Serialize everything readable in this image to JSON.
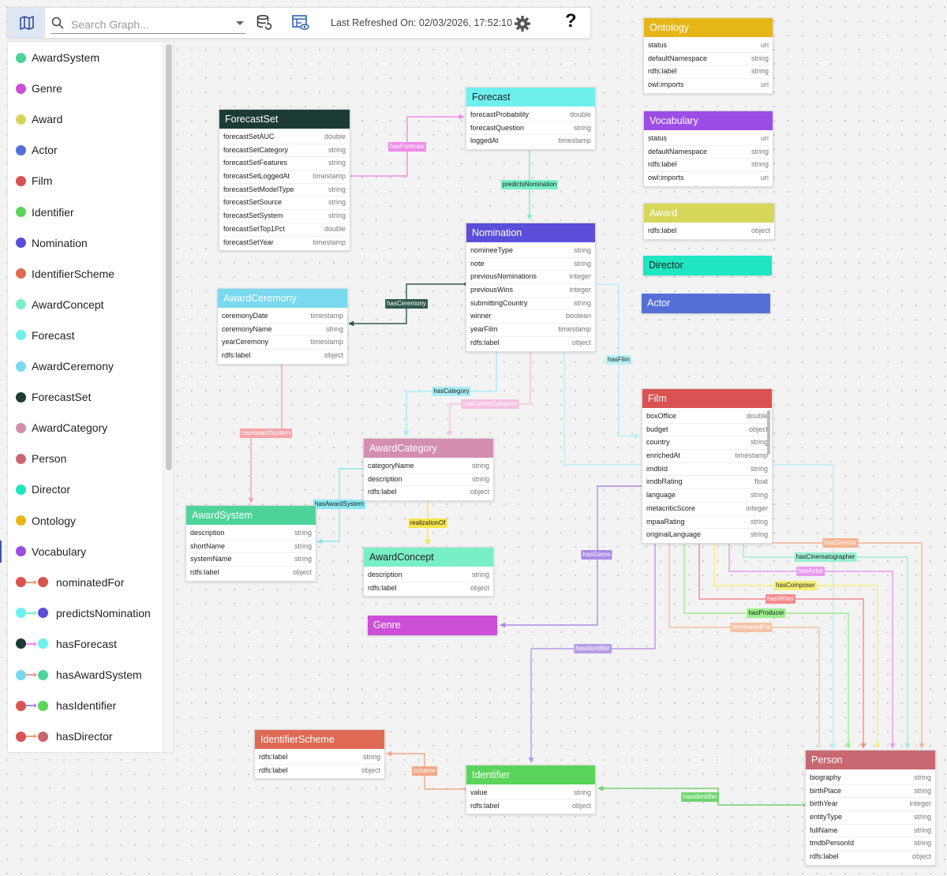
{
  "toolbar": {
    "search_placeholder": "Search Graph...",
    "last_refreshed": "Last Refreshed On: 02/03/2026, 17:52:10",
    "help": "?"
  },
  "legend": {
    "nodes": [
      {
        "label": "AwardSystem",
        "color": "#4ed39a"
      },
      {
        "label": "Genre",
        "color": "#cc4fd8"
      },
      {
        "label": "Award",
        "color": "#d6d65a"
      },
      {
        "label": "Actor",
        "color": "#5470d6"
      },
      {
        "label": "Film",
        "color": "#d95352"
      },
      {
        "label": "Identifier",
        "color": "#5ad45a"
      },
      {
        "label": "Nomination",
        "color": "#5b4ed8"
      },
      {
        "label": "IdentifierScheme",
        "color": "#df6a53"
      },
      {
        "label": "AwardConcept",
        "color": "#79efc6"
      },
      {
        "label": "Forecast",
        "color": "#6ef0ef"
      },
      {
        "label": "AwardCeremony",
        "color": "#79d9ef"
      },
      {
        "label": "ForecastSet",
        "color": "#1d3b35"
      },
      {
        "label": "AwardCategory",
        "color": "#d48fb0"
      },
      {
        "label": "Person",
        "color": "#c96870"
      },
      {
        "label": "Director",
        "color": "#1de6c0"
      },
      {
        "label": "Ontology",
        "color": "#e6b619"
      },
      {
        "label": "Vocabulary",
        "color": "#9b4de6"
      }
    ],
    "edges": [
      {
        "label": "nominatedFor",
        "from": "#d95352",
        "line": "#f2a07a",
        "to": "#d95352"
      },
      {
        "label": "predictsNomination",
        "from": "#6ef0ef",
        "line": "#79efc6",
        "to": "#5b4ed8"
      },
      {
        "label": "hasForecast",
        "from": "#1d3b35",
        "line": "#f08be8",
        "to": "#6ef0ef"
      },
      {
        "label": "hasAwardSystem",
        "from": "#79d9ef",
        "line": "#f09aa0",
        "to": "#4ed39a"
      },
      {
        "label": "hasIdentifier",
        "from": "#d95352",
        "line": "#a98ae6",
        "to": "#5ad45a"
      },
      {
        "label": "hasDirector",
        "from": "#d95352",
        "line": "#f2a07a",
        "to": "#c96870"
      }
    ]
  },
  "nodes": {
    "forecastset": {
      "title": "ForecastSet",
      "color": "#1d3b35",
      "rows": [
        [
          "forecastSetAUC",
          "double"
        ],
        [
          "forecastSetCategory",
          "string"
        ],
        [
          "forecastSetFeatures",
          "string"
        ],
        [
          "forecastSetLoggedAt",
          "timestamp"
        ],
        [
          "forecastSetModelType",
          "string"
        ],
        [
          "forecastSetSource",
          "string"
        ],
        [
          "forecastSetSystem",
          "string"
        ],
        [
          "forecastSetTop1Pct",
          "double"
        ],
        [
          "forecastSetYear",
          "timestamp"
        ]
      ]
    },
    "forecast": {
      "title": "Forecast",
      "color": "#6ef0ef",
      "dark": true,
      "rows": [
        [
          "forecastProbability",
          "double"
        ],
        [
          "forecastQuestion",
          "string"
        ],
        [
          "loggedAt",
          "timestamp"
        ]
      ]
    },
    "ontology": {
      "title": "Ontology",
      "color": "#e6b619",
      "rows": [
        [
          "status",
          "uri"
        ],
        [
          "defaultNamespace",
          "string"
        ],
        [
          "rdfs:label",
          "string"
        ],
        [
          "owl:imports",
          "uri"
        ]
      ]
    },
    "vocabulary": {
      "title": "Vocabulary",
      "color": "#9b4de6",
      "rows": [
        [
          "status",
          "uri"
        ],
        [
          "defaultNamespace",
          "string"
        ],
        [
          "rdfs:label",
          "string"
        ],
        [
          "owl:imports",
          "uri"
        ]
      ]
    },
    "award": {
      "title": "Award",
      "color": "#d6d65a",
      "rows": [
        [
          "rdfs:label",
          "object"
        ]
      ]
    },
    "director": {
      "title": "Director",
      "color": "#1de6c0",
      "dark": true,
      "rows": []
    },
    "actor": {
      "title": "Actor",
      "color": "#5470d6",
      "rows": []
    },
    "nomination": {
      "title": "Nomination",
      "color": "#5b4ed8",
      "rows": [
        [
          "nomineeType",
          "string"
        ],
        [
          "note",
          "string"
        ],
        [
          "previousNominations",
          "integer"
        ],
        [
          "previousWins",
          "integer"
        ],
        [
          "submittingCountry",
          "string"
        ],
        [
          "winner",
          "boolean"
        ],
        [
          "yearFilm",
          "timestamp"
        ],
        [
          "rdfs:label",
          "object"
        ]
      ]
    },
    "awardceremony": {
      "title": "AwardCeremony",
      "color": "#79d9ef",
      "rows": [
        [
          "ceremonyDate",
          "timestamp"
        ],
        [
          "ceremonyName",
          "string"
        ],
        [
          "yearCeremony",
          "timestamp"
        ],
        [
          "rdfs:label",
          "object"
        ]
      ]
    },
    "film": {
      "title": "Film",
      "color": "#d95352",
      "rows": [
        [
          "boxOffice",
          "double"
        ],
        [
          "budget",
          "object"
        ],
        [
          "country",
          "string"
        ],
        [
          "enrichedAt",
          "timestamp"
        ],
        [
          "imdbId",
          "string"
        ],
        [
          "imdbRating",
          "float"
        ],
        [
          "language",
          "string"
        ],
        [
          "metacriticScore",
          "integer"
        ],
        [
          "mpaaRating",
          "string"
        ],
        [
          "originalLanguage",
          "string"
        ]
      ]
    },
    "awardcategory": {
      "title": "AwardCategory",
      "color": "#d48fb0",
      "rows": [
        [
          "categoryName",
          "string"
        ],
        [
          "description",
          "string"
        ],
        [
          "rdfs:label",
          "object"
        ]
      ]
    },
    "awardsystem": {
      "title": "AwardSystem",
      "color": "#4ed39a",
      "rows": [
        [
          "description",
          "string"
        ],
        [
          "shortName",
          "string"
        ],
        [
          "systemName",
          "string"
        ],
        [
          "rdfs:label",
          "object"
        ]
      ]
    },
    "awardconcept": {
      "title": "AwardConcept",
      "color": "#79efc6",
      "dark": true,
      "rows": [
        [
          "description",
          "string"
        ],
        [
          "rdfs:label",
          "object"
        ]
      ]
    },
    "genre": {
      "title": "Genre",
      "color": "#cc4fd8",
      "rows": []
    },
    "identifierscheme": {
      "title": "IdentifierScheme",
      "color": "#df6a53",
      "rows": [
        [
          "rdfs:label",
          "string"
        ],
        [
          "rdfs:label",
          "object"
        ]
      ]
    },
    "identifier": {
      "title": "Identifier",
      "color": "#5ad45a",
      "rows": [
        [
          "value",
          "string"
        ],
        [
          "rdfs:label",
          "object"
        ]
      ]
    },
    "person": {
      "title": "Person",
      "color": "#c96870",
      "rows": [
        [
          "biography",
          "string"
        ],
        [
          "birthPlace",
          "string"
        ],
        [
          "birthYear",
          "integer"
        ],
        [
          "entityType",
          "string"
        ],
        [
          "fullName",
          "string"
        ],
        [
          "tmdbPersonId",
          "string"
        ],
        [
          "rdfs:label",
          "object"
        ]
      ]
    }
  },
  "edges": [
    {
      "label": "hasForecast",
      "color": "#f08be8",
      "text": "#fff"
    },
    {
      "label": "predictsNomination",
      "color": "#79efc6",
      "text": "#222"
    },
    {
      "label": "hasCeremony",
      "color": "#2f5a50",
      "text": "#fff"
    },
    {
      "label": "hasFilm",
      "color": "#b5f0f5",
      "text": "#222"
    },
    {
      "label": "hasCategory",
      "color": "#a9ecf5",
      "text": "#222"
    },
    {
      "label": "hasCanonCategory",
      "color": "#f6c0e0",
      "text": "#fff"
    },
    {
      "label": "hasAwardSystem",
      "color": "#f6a3a8",
      "text": "#fff"
    },
    {
      "label": "hasAwardSystem",
      "color": "#8ae8f2",
      "text": "#222"
    },
    {
      "label": "realizationOf",
      "color": "#f6e64a",
      "text": "#222"
    },
    {
      "label": "hasGenre",
      "color": "#a98ae6",
      "text": "#fff"
    },
    {
      "label": "hasIdentifier",
      "color": "#b79be8",
      "text": "#fff"
    },
    {
      "label": "scheme",
      "color": "#f2a887",
      "text": "#fff"
    },
    {
      "label": "hasIdentifier",
      "color": "#6ed46e",
      "text": "#fff"
    },
    {
      "label": "hasDirector",
      "color": "#f5b590",
      "text": "#fff"
    },
    {
      "label": "hasCinematographer",
      "color": "#9af0d2",
      "text": "#222"
    },
    {
      "label": "hasActor",
      "color": "#ec9af0",
      "text": "#fff"
    },
    {
      "label": "hasComposer",
      "color": "#f5f076",
      "text": "#222"
    },
    {
      "label": "hasWriter",
      "color": "#f58a8a",
      "text": "#fff"
    },
    {
      "label": "hasProducer",
      "color": "#9af08a",
      "text": "#222"
    },
    {
      "label": "nominatedFor",
      "color": "#f5c2a3",
      "text": "#fff"
    }
  ]
}
